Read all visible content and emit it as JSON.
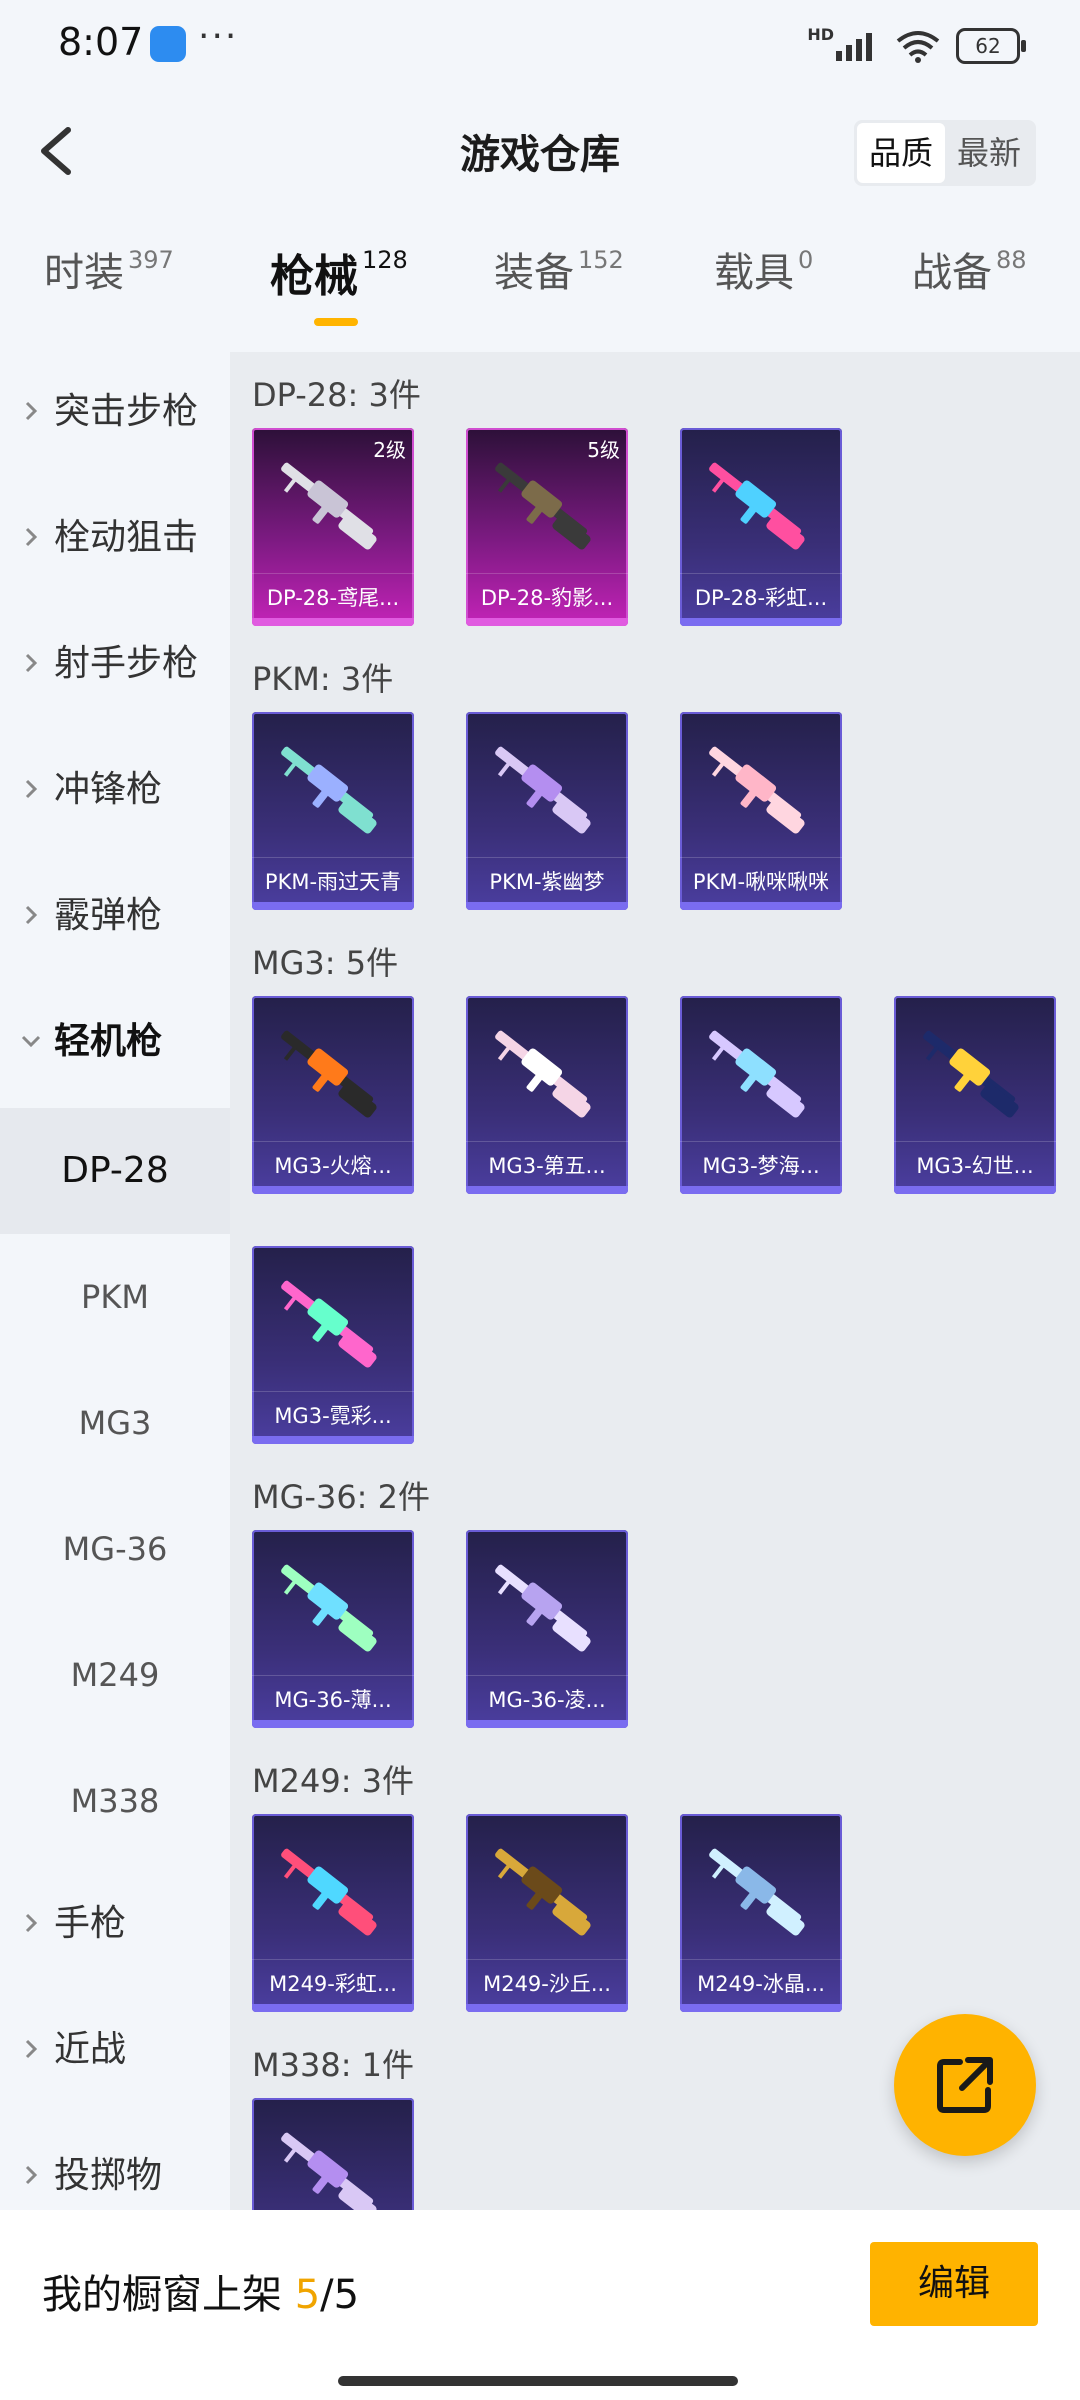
{
  "status_bar": {
    "time": "8:07",
    "dots": "···",
    "hd": "HD",
    "battery": "62"
  },
  "header": {
    "title": "游戏仓库",
    "sort_options": [
      "品质",
      "最新"
    ],
    "sort_active": "品质"
  },
  "tabs": [
    {
      "label": "时装",
      "count": "397"
    },
    {
      "label": "枪械",
      "count": "128",
      "active": true
    },
    {
      "label": "装备",
      "count": "152"
    },
    {
      "label": "载具",
      "count": "0"
    },
    {
      "label": "战备",
      "count": "88"
    }
  ],
  "sidebar": {
    "categories_top": [
      "突击步枪",
      "栓动狙击",
      "射手步枪",
      "冲锋枪",
      "霰弹枪"
    ],
    "expanded": "轻机枪",
    "sub_items": [
      "DP-28",
      "PKM",
      "MG3",
      "MG-36",
      "M249",
      "M338"
    ],
    "selected_sub": "DP-28",
    "categories_bottom": [
      "手枪",
      "近战",
      "投掷物"
    ]
  },
  "groups": [
    {
      "title": "DP-28: 3件",
      "items": [
        {
          "name": "DP-28-鸢尾...",
          "level": "2级",
          "rarity": "magenta",
          "palette": [
            "#e0e0e6",
            "#c9c4d6"
          ]
        },
        {
          "name": "DP-28-豹影...",
          "level": "5级",
          "rarity": "magenta",
          "palette": [
            "#3a3a3a",
            "#7c6b4a"
          ]
        },
        {
          "name": "DP-28-彩虹...",
          "level": "",
          "rarity": "purple",
          "palette": [
            "#ff4fa0",
            "#4fd1ff"
          ]
        }
      ]
    },
    {
      "title": "PKM: 3件",
      "items": [
        {
          "name": "PKM-雨过天青",
          "level": "",
          "rarity": "purple",
          "palette": [
            "#7fe0d0",
            "#9bb0ff"
          ]
        },
        {
          "name": "PKM-紫幽梦",
          "level": "",
          "rarity": "purple",
          "palette": [
            "#d9c8f5",
            "#b48ef0"
          ]
        },
        {
          "name": "PKM-啾咪啾咪",
          "level": "",
          "rarity": "purple",
          "palette": [
            "#ffd6e0",
            "#ffb6c8"
          ]
        }
      ]
    },
    {
      "title": "MG3: 5件",
      "items": [
        {
          "name": "MG3-火熔...",
          "level": "",
          "rarity": "purple",
          "palette": [
            "#2a2a2a",
            "#ff7a1a"
          ]
        },
        {
          "name": "MG3-第五...",
          "level": "",
          "rarity": "purple",
          "palette": [
            "#f5d5e6",
            "#ffffff"
          ]
        },
        {
          "name": "MG3-梦海...",
          "level": "",
          "rarity": "purple",
          "palette": [
            "#d7c8ff",
            "#8ee0ff"
          ]
        },
        {
          "name": "MG3-幻世...",
          "level": "",
          "rarity": "purple",
          "palette": [
            "#1d2a6a",
            "#ffd23a"
          ]
        },
        {
          "name": "MG3-霓彩...",
          "level": "",
          "rarity": "purple",
          "palette": [
            "#ff66cc",
            "#66ffcc"
          ]
        }
      ]
    },
    {
      "title": "MG-36: 2件",
      "items": [
        {
          "name": "MG-36-薄...",
          "level": "",
          "rarity": "purple",
          "palette": [
            "#9effc0",
            "#6fe0ff"
          ]
        },
        {
          "name": "MG-36-凌...",
          "level": "",
          "rarity": "purple",
          "palette": [
            "#e8e0ff",
            "#b7a3f0"
          ]
        }
      ]
    },
    {
      "title": "M249: 3件",
      "items": [
        {
          "name": "M249-彩虹...",
          "level": "",
          "rarity": "purple",
          "palette": [
            "#ff4f7a",
            "#4fd8ff"
          ]
        },
        {
          "name": "M249-沙丘...",
          "level": "",
          "rarity": "purple",
          "palette": [
            "#d8a83a",
            "#6b4a1a"
          ]
        },
        {
          "name": "M249-冰晶...",
          "level": "",
          "rarity": "purple",
          "palette": [
            "#d0f0ff",
            "#8ab8e8"
          ]
        }
      ]
    },
    {
      "title": "M338: 1件",
      "items": [
        {
          "name": "",
          "level": "",
          "rarity": "purple",
          "palette": [
            "#d9c8f5",
            "#b48ef0"
          ]
        }
      ]
    }
  ],
  "bottom_bar": {
    "shelf_prefix": "我的橱窗上架 ",
    "shelf_current": "5",
    "shelf_total": "/5",
    "edit_label": "编辑"
  },
  "colors": {
    "accent": "#ffb300",
    "card_purple": "#3a2f78",
    "card_magenta": "#c423b8"
  }
}
